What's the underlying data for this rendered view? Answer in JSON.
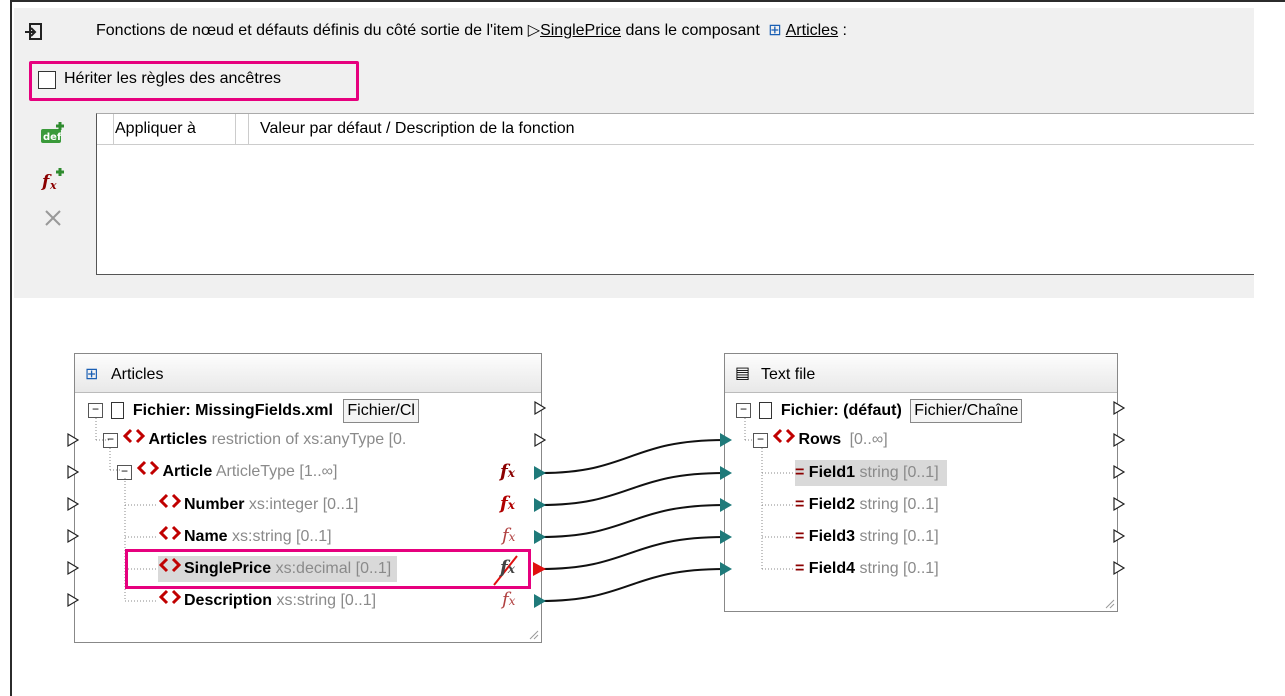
{
  "header": {
    "prefix": "Fonctions de nœud et défauts définis du côté sortie de l'item",
    "item_link": "SinglePrice",
    "middle": "dans le composant",
    "component_link": "Articles",
    "suffix": ":"
  },
  "inherit": {
    "label": "Hériter les règles des ancêtres",
    "checked": false
  },
  "grid": {
    "col_apply": "Appliquer à",
    "col_value": "Valeur par défaut / Description de la fonction"
  },
  "toolbar": {
    "def_icon": "def",
    "fx_icon": "fx",
    "delete_icon": "delete-icon"
  },
  "articles": {
    "title": "Articles",
    "file_label": "Fichier: MissingFields.xml",
    "file_box": "Fichier/Cl",
    "rows": [
      {
        "name": "Articles",
        "type": "restriction of xs:anyType [0."
      },
      {
        "name": "Article",
        "type": "ArticleType [1..∞]"
      },
      {
        "name": "Number",
        "type": "xs:integer [0..1]"
      },
      {
        "name": "Name",
        "type": "xs:string [0..1]"
      },
      {
        "name": "SinglePrice",
        "type": "xs:decimal [0..1]"
      },
      {
        "name": "Description",
        "type": "xs:string [0..1]"
      }
    ]
  },
  "textfile": {
    "title": "Text file",
    "file_label": "Fichier: (défaut)",
    "file_box": "Fichier/Chaîne",
    "rows": [
      {
        "name": "Rows",
        "type": "[0..∞]"
      },
      {
        "name": "Field1",
        "type": "string [0..1]"
      },
      {
        "name": "Field2",
        "type": "string [0..1]"
      },
      {
        "name": "Field3",
        "type": "string [0..1]"
      },
      {
        "name": "Field4",
        "type": "string [0..1]"
      }
    ]
  },
  "colors": {
    "accent": "#e6007e",
    "element": "#c00000",
    "connector": "#1f7a7a"
  }
}
